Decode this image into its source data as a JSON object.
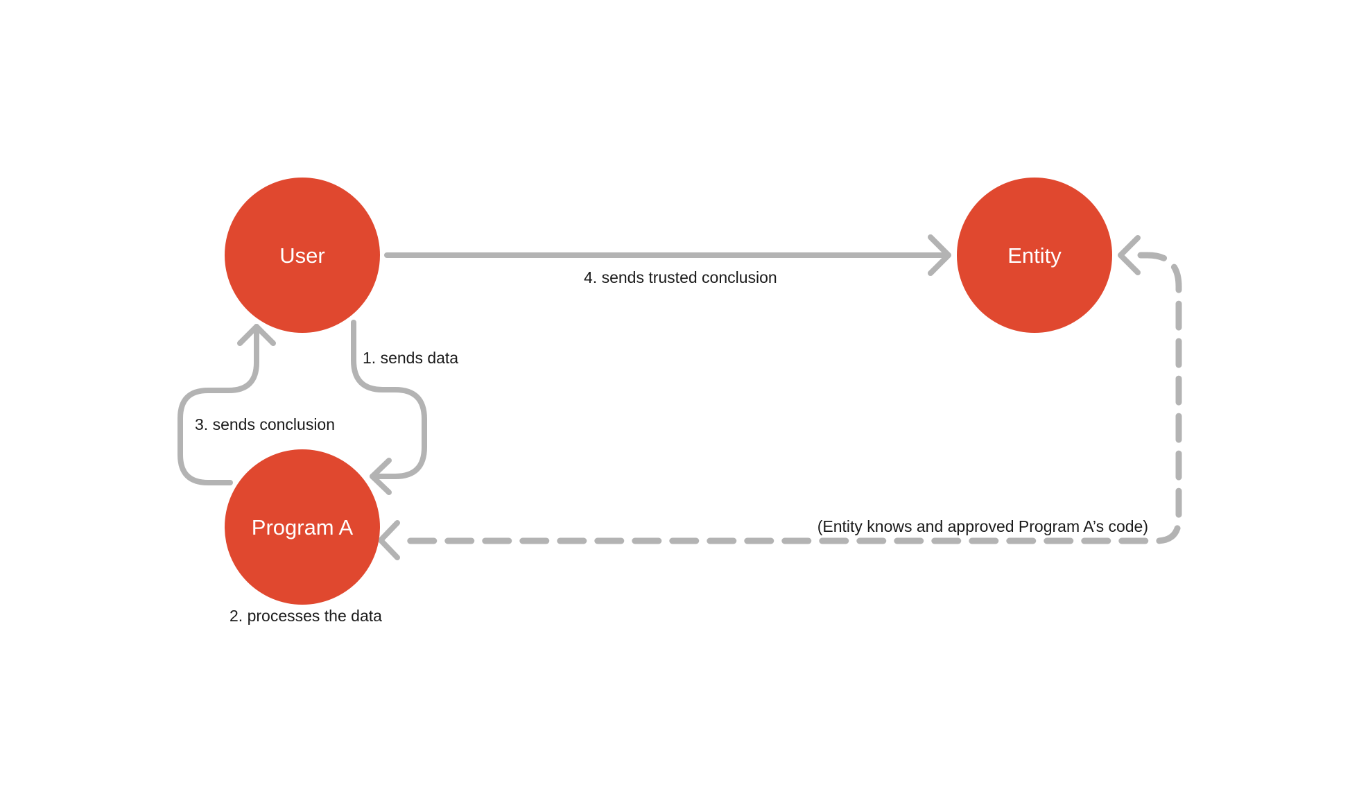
{
  "diagram": {
    "colors": {
      "node_fill": "#E0482F",
      "node_text": "#FFFFFF",
      "connector": "#B3B3B3",
      "label_text": "#1A1A1A",
      "background": "#FFFFFF"
    },
    "nodes": {
      "user": {
        "label": "User"
      },
      "entity": {
        "label": "Entity"
      },
      "program_a": {
        "label": "Program A"
      }
    },
    "edges": {
      "step1": {
        "label": "1. sends data",
        "from": "User",
        "to": "Program A",
        "style": "solid"
      },
      "step2": {
        "label": "2. processes the data",
        "at": "Program A"
      },
      "step3": {
        "label": "3. sends conclusion",
        "from": "Program A",
        "to": "User",
        "style": "solid"
      },
      "step4": {
        "label": "4. sends trusted conclusion",
        "from": "User",
        "to": "Entity",
        "style": "solid"
      },
      "trust": {
        "label": "(Entity knows and approved Program A’s code)",
        "from": "Entity",
        "to": "Program A",
        "style": "dashed"
      }
    }
  }
}
